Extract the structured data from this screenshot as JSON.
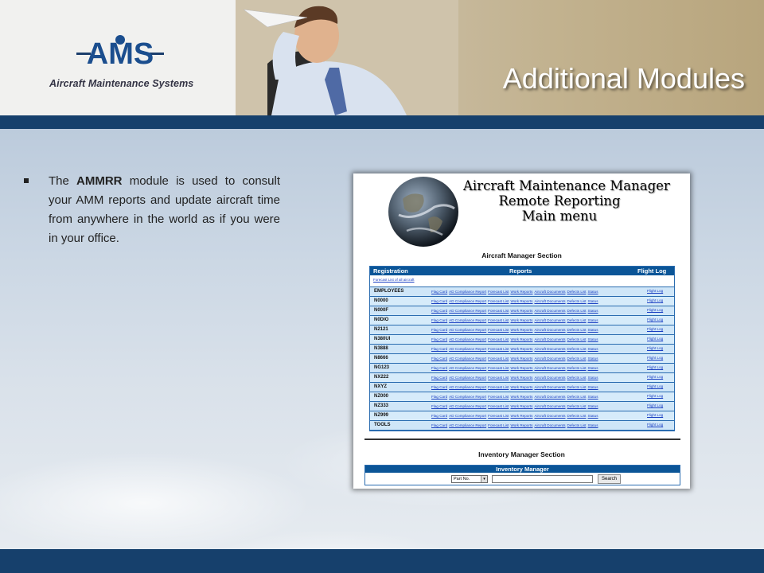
{
  "header": {
    "logo_text": "AMS",
    "logo_subtitle": "Aircraft Maintenance Systems",
    "title": "Additional Modules"
  },
  "bullet": {
    "prefix": "The ",
    "bold": "AMMRR",
    "suffix": " module is used to consult your AMM reports and update aircraft time from anywhere in the world as if you were in your office."
  },
  "screenshot": {
    "title_lines": [
      "Aircraft Maintenance Manager",
      "Remote Reporting",
      "Main menu"
    ],
    "aircraft_section_title": "Aircraft Manager Section",
    "columns": {
      "registration": "Registration",
      "reports": "Reports",
      "flight_log": "Flight Log"
    },
    "forecast_link": "Forecast List of all aircraft",
    "report_links": [
      "Flag Card",
      "AD Compliance  Report",
      "Forecast List",
      "Work Reports",
      "Aircraft Documents",
      "Defects List",
      "Status"
    ],
    "flight_log_link": "Flight Log",
    "rows": [
      "EMPLOYEES",
      "N0000",
      "N000F",
      "N0DIO",
      "N2121",
      "N380UI",
      "N3888",
      "N8666",
      "NG123",
      "NX222",
      "NXYZ",
      "NZ000",
      "NZ333",
      "NZ999",
      "TOOLS"
    ],
    "inventory_section_title": "Inventory Manager Section",
    "inventory": {
      "header": "Inventory Manager",
      "select_value": "Part No.",
      "search_button": "Search"
    }
  },
  "colors": {
    "bar": "#16406c",
    "grid_header": "#0b5597",
    "row_bg": "#d6ebfa",
    "link": "#1a3fc2"
  }
}
